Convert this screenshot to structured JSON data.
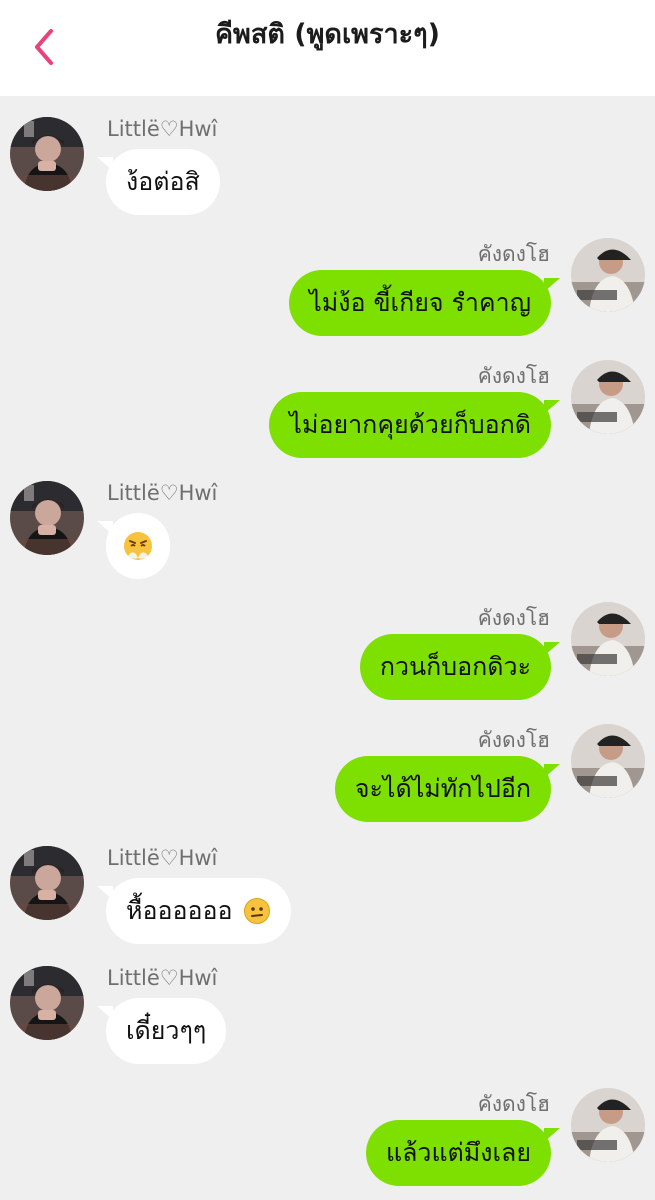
{
  "header": {
    "title": "คีพสติ (พูดเพราะๆ)",
    "back_icon": "chevron-left-icon",
    "accent": "#e9437c"
  },
  "colors": {
    "background": "#efefef",
    "bubble_incoming": "#ffffff",
    "bubble_outgoing": "#7ee000"
  },
  "messages": [
    {
      "sender": "Littlë♡Hwî",
      "side": "left",
      "text": "ง้อต่อสิ"
    },
    {
      "sender": "คังดงโฮ",
      "side": "right",
      "text": "ไม่ง้อ ขี้เกียจ รำคาญ"
    },
    {
      "sender": "คังดงโฮ",
      "side": "right",
      "text": "ไม่อยากคุยด้วยก็บอกดิ"
    },
    {
      "sender": "Littlë♡Hwî",
      "side": "left",
      "text": "",
      "emoji": "pouting-face-emoji"
    },
    {
      "sender": "คังดงโฮ",
      "side": "right",
      "text": "กวนก็บอกดิวะ"
    },
    {
      "sender": "คังดงโฮ",
      "side": "right",
      "text": "จะได้ไม่ทักไปอีก"
    },
    {
      "sender": "Littlë♡Hwî",
      "side": "left",
      "text": "หื้ออออออ",
      "emoji": "neutral-face-emoji"
    },
    {
      "sender": "Littlë♡Hwî",
      "side": "left",
      "text": "เดี๋ยวๆๆ"
    },
    {
      "sender": "คังดงโฮ",
      "side": "right",
      "text": "แล้วแต่มึงเลย"
    }
  ]
}
